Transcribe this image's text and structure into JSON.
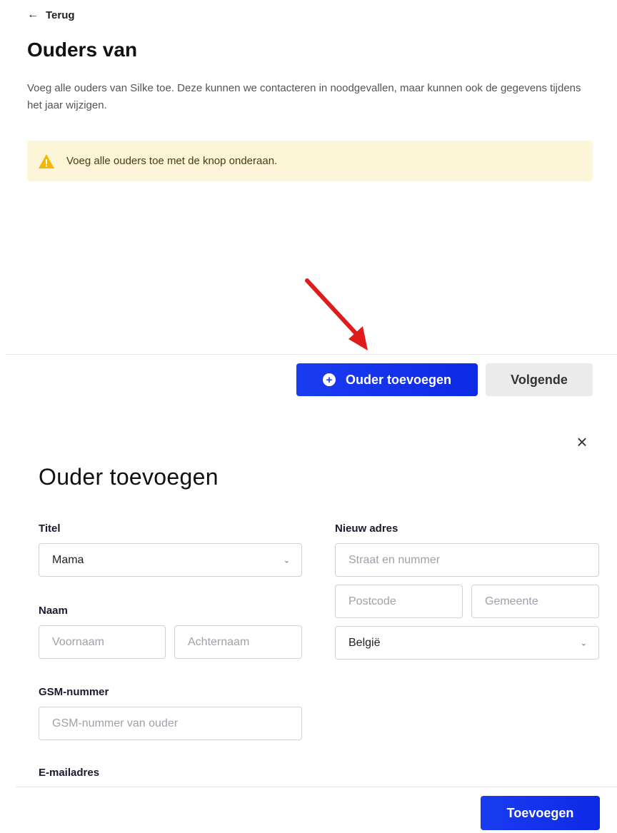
{
  "nav": {
    "back_label": "Terug"
  },
  "page": {
    "title": "Ouders van",
    "intro": "Voeg alle ouders van Silke toe. Deze kunnen we contacteren in noodgevallen, maar kunnen ook de gegevens tijdens het jaar wijzigen."
  },
  "warning": {
    "text": "Voeg alle ouders toe met de knop onderaan."
  },
  "actions": {
    "add_parent_label": "Ouder toevoegen",
    "next_label": "Volgende"
  },
  "modal": {
    "title": "Ouder toevoegen",
    "titel_label": "Titel",
    "titel_value": "Mama",
    "naam_label": "Naam",
    "voornaam_placeholder": "Voornaam",
    "achternaam_placeholder": "Achternaam",
    "gsm_label": "GSM-nummer",
    "gsm_placeholder": "GSM-nummer van ouder",
    "email_label": "E-mailadres",
    "address_label": "Nieuw adres",
    "street_placeholder": "Straat en nummer",
    "postcode_placeholder": "Postcode",
    "gemeente_placeholder": "Gemeente",
    "country_value": "België",
    "submit_label": "Toevoegen"
  },
  "colors": {
    "primary": "#1a3cf0",
    "warning_bg": "#fdf5d8",
    "warning_icon": "#f5b800",
    "arrow": "#e01b1b"
  }
}
